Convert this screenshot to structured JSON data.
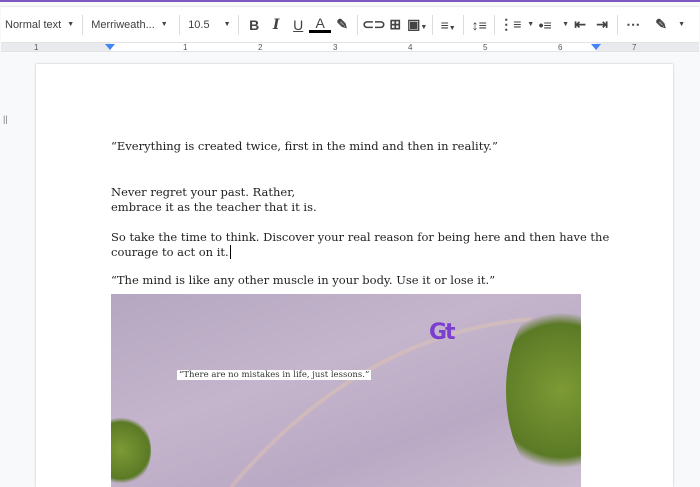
{
  "toolbar": {
    "style": "Normal text",
    "font": "Merriweath...",
    "size": "10.5",
    "icons": [
      "bold-icon",
      "italic-icon",
      "underline-icon",
      "text-color-icon",
      "highlight-icon",
      "link-icon",
      "comment-icon",
      "image-icon",
      "align-icon",
      "line-spacing-icon",
      "numbered-list-icon",
      "bulleted-list-icon",
      "decrease-indent-icon",
      "increase-indent-icon",
      "more-icon",
      "edit-mode-icon"
    ],
    "bold": "B",
    "italic": "I",
    "underline": "U",
    "textcolor": "A",
    "more": "⋯"
  },
  "ruler": {
    "labels": [
      "1",
      "1",
      "2",
      "3",
      "4",
      "5",
      "6",
      "7"
    ]
  },
  "document": {
    "lines": [
      "“Everything is created twice, first in the mind and then in reality.”",
      "Never regret your past. Rather,",
      "embrace it as the teacher that it is.",
      "So take the time to think. Discover your real reason for being here and then have the",
      "courage to act on it.",
      "“The mind is like any other muscle in your body. Use it or lose it.”"
    ],
    "image_caption": "“There are no mistakes in life, just lessons.”",
    "logo": "Gt"
  },
  "colors": {
    "accent": "#4285f4",
    "frame": "#7e57c2"
  }
}
